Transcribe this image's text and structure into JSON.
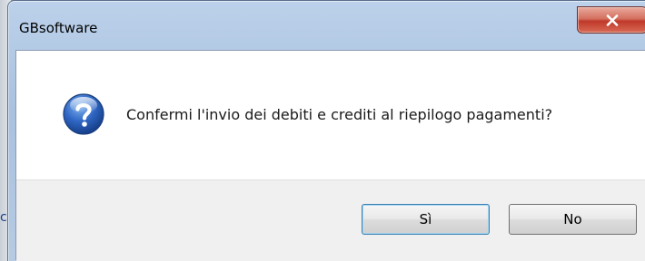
{
  "window": {
    "title": "GBsoftware",
    "close_icon": "close-icon"
  },
  "dialog": {
    "icon": "question-icon",
    "message": "Confermi l'invio dei debiti e crediti al riepilogo pagamenti?"
  },
  "buttons": {
    "yes_label": "Sì",
    "no_label": "No"
  },
  "background": {
    "fragment": "c"
  },
  "colors": {
    "close_button": "#c0392b",
    "icon_blue": "#1c4fa0",
    "button_area": "#f0f0f0"
  }
}
